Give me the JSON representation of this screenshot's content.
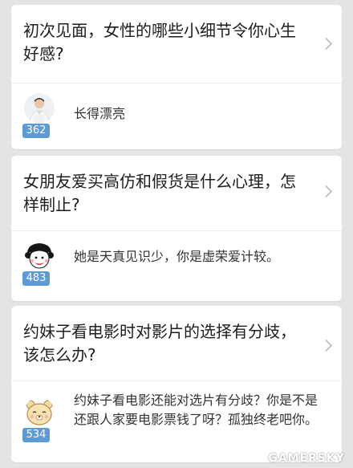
{
  "cards": [
    {
      "question": "初次见面，女性的哪些小细节令你心生好感?",
      "answer": "长得漂亮",
      "votes": "362",
      "avatar_icon": "man-avatar-icon"
    },
    {
      "question": "女朋友爱买高仿和假货是什么心理，怎样制止?",
      "answer": "她是天真见识少，你是虚荣爱计较。",
      "votes": "483",
      "avatar_icon": "cartoon-girl-avatar-icon"
    },
    {
      "question": "约妹子看电影时对影片的选择有分歧，该怎么办?",
      "answer": "约妹子看电影还能对选片有分歧？你是不是还跟人家要电影票钱了呀？孤独终老吧你。",
      "votes": "534",
      "avatar_icon": "cartoon-bear-avatar-icon"
    }
  ],
  "watermark": "GAMERSKY",
  "colors": {
    "background": "#e4e4e4",
    "card": "#ffffff",
    "vote_badge": "#5d9bd6",
    "chevron": "#c2c2c2"
  }
}
